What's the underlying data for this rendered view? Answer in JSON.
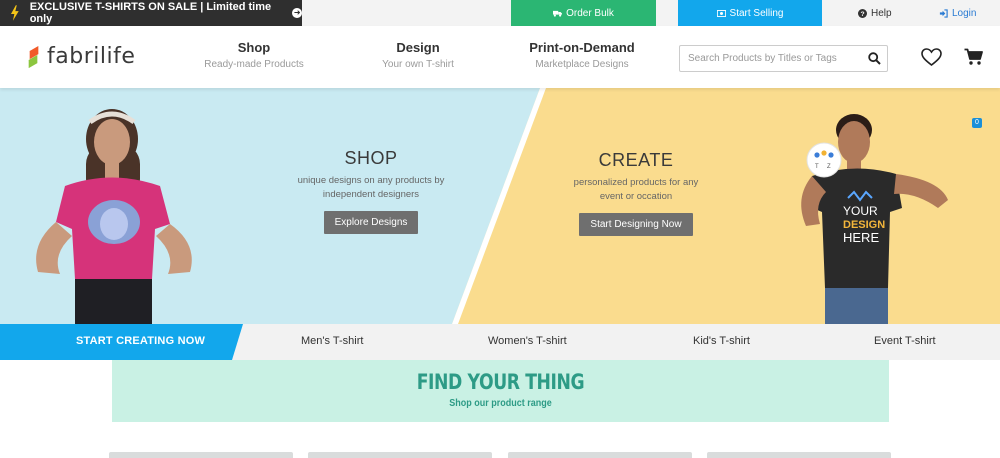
{
  "topbar": {
    "promo_text": "EXCLUSIVE T-SHIRTS ON SALE | Limited time only",
    "order_bulk": "Order Bulk",
    "start_selling": "Start Selling",
    "help": "Help",
    "login": "Login"
  },
  "header": {
    "logo_text": "fabrilife",
    "nav": [
      {
        "title": "Shop",
        "subtitle": "Ready-made Products"
      },
      {
        "title": "Design",
        "subtitle": "Your own T-shirt"
      },
      {
        "title": "Print-on-Demand",
        "subtitle": "Marketplace Designs"
      }
    ],
    "search_placeholder": "Search Products by Titles or Tags"
  },
  "hero": {
    "shop": {
      "heading": "SHOP",
      "line1": "unique designs on any products by",
      "line2": "independent designers",
      "button": "Explore Designs"
    },
    "create": {
      "heading": "CREATE",
      "line1": "personalized products for any",
      "line2": "event or occation",
      "button": "Start Designing Now"
    },
    "tshirt_print": [
      "YOUR",
      "DESIGN",
      "HERE"
    ],
    "badge_count": "0",
    "colors": {
      "shop_bg": "#c9eaf2",
      "create_bg": "#fadc8e"
    }
  },
  "categories": {
    "cta": "START CREATING NOW",
    "items": [
      "Men's T-shirt",
      "Women's T-shirt",
      "Kid's T-shirt",
      "Event T-shirt"
    ],
    "cta_color": "#12a7ec"
  },
  "find": {
    "heading": "FIND YOUR THING",
    "subheading": "Shop our product range"
  },
  "icons": [
    "bolt-icon",
    "arrow-circle-icon",
    "truck-icon",
    "money-icon",
    "question-icon",
    "login-icon",
    "search-icon",
    "heart-icon",
    "cart-icon"
  ]
}
